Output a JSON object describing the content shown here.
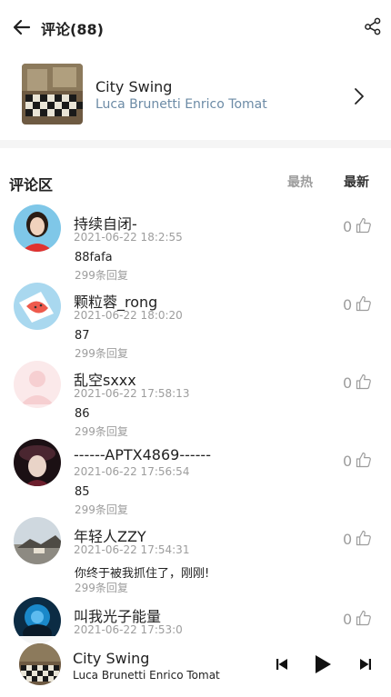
{
  "header": {
    "title": "评论(88)",
    "back_icon": "back-arrow-icon",
    "share_icon": "share-icon"
  },
  "song": {
    "name": "City Swing",
    "artist": "Luca Brunetti Enrico Tomat"
  },
  "comments_section": {
    "title": "评论区",
    "sort_hot": "最热",
    "sort_new": "最新"
  },
  "comments": [
    {
      "username": "持续自闭-",
      "time": "2021-06-22 18:2:55",
      "likes": "0",
      "content": "88fafa",
      "replies": "299条回复"
    },
    {
      "username": "颗粒蓉_rong",
      "time": "2021-06-22 18:0:20",
      "likes": "0",
      "content": "87",
      "replies": "299条回复"
    },
    {
      "username": "乱空sxxx",
      "time": "2021-06-22 17:58:13",
      "likes": "0",
      "content": "86",
      "replies": "299条回复"
    },
    {
      "username": "------APTX4869------",
      "time": "2021-06-22 17:56:54",
      "likes": "0",
      "content": "85",
      "replies": "299条回复"
    },
    {
      "username": "年轻人ZZY",
      "time": "2021-06-22 17:54:31",
      "likes": "0",
      "content": "你终于被我抓住了，刚刚!",
      "replies": "299条回复"
    },
    {
      "username": "叫我光子能量",
      "time": "2021-06-22 17:53:0",
      "likes": "0",
      "content": "",
      "replies": ""
    }
  ],
  "player": {
    "name": "City Swing",
    "artist": "Luca Brunetti Enrico Tomat"
  },
  "colors": {
    "artist_link": "#6c8ba6",
    "muted": "#9d9d9d",
    "band": "#f5f5f5"
  }
}
